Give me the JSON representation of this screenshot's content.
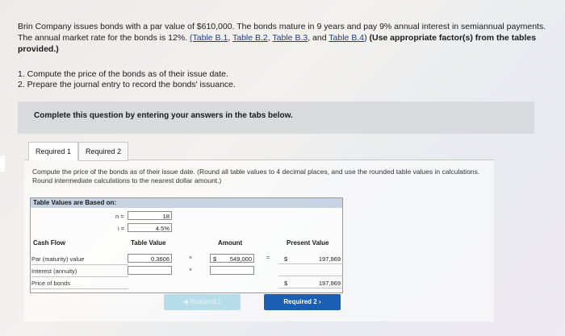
{
  "problem": {
    "text_pre": "Brin Company issues bonds with a par value of $610,000. The bonds mature in 9 years and pay 9% annual interest in semiannual payments. The annual market rate for the bonds is 12%. ",
    "link_b1": "(Table B.1",
    "link_b2": "Table B.2",
    "link_b3": "Table B.3",
    "link_and": ", and ",
    "link_b4": "Table B.4",
    "text_close": ")",
    "bold_instruction": "(Use appropriate factor(s) from the tables provided.)"
  },
  "tasks": [
    "1. Compute the price of the bonds as of their issue date.",
    "2. Prepare the journal entry to record the bonds' issuance."
  ],
  "banner": "Complete this question by entering your answers in the tabs below.",
  "tabs": [
    "Required 1",
    "Required 2"
  ],
  "instructions": "Compute the price of the bonds as of their issue date. (Round all table values to 4 decimal places, and use the rounded table values in calculations. Round intermediate calculations to the nearest dollar amount.)",
  "table": {
    "header": "Table Values are Based on:",
    "n_label": "n =",
    "i_label": "i =",
    "n_value": "18",
    "i_value": "4.5%",
    "col_cash_flow": "Cash Flow",
    "col_table_value": "Table Value",
    "col_amount": "Amount",
    "col_present_value": "Present Value",
    "rows": [
      {
        "label": "Par (maturity) value",
        "table_value": "0.3606",
        "op1": "×",
        "dollar": "$",
        "amount": "549,000",
        "op2": "=",
        "pv_dollar": "$",
        "pv": "197,969"
      },
      {
        "label": "Interest (annuity)",
        "table_value": "",
        "op1": "×",
        "amount": "",
        "op2": "",
        "pv_dollar": "",
        "pv": ""
      },
      {
        "label": "Price of bonds",
        "pv_dollar": "$",
        "pv": "197,969"
      }
    ]
  },
  "buttons": {
    "prev": "◀  Required 1",
    "next": "Required 2  ›"
  }
}
